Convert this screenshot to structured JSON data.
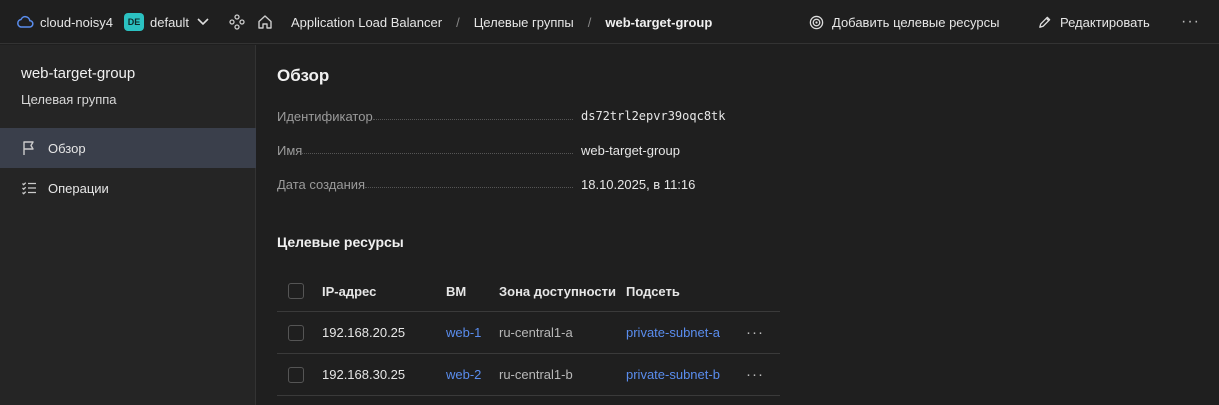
{
  "topbar": {
    "cloud_name": "cloud-noisy4",
    "folder_badge": "DE",
    "folder_name": "default",
    "breadcrumbs": [
      "Application Load Balancer",
      "Целевые группы",
      "web-target-group"
    ],
    "breadcrumb_sep": "/",
    "add_resources_label": "Добавить целевые ресурсы",
    "edit_label": "Редактировать",
    "more_label": "···"
  },
  "sidebar": {
    "title": "web-target-group",
    "subtitle": "Целевая группа",
    "items": [
      {
        "label": "Обзор",
        "icon": "flag-icon",
        "active": true
      },
      {
        "label": "Операции",
        "icon": "list-check-icon",
        "active": false
      }
    ]
  },
  "overview": {
    "heading": "Обзор",
    "properties": [
      {
        "key": "Идентификатор",
        "value": "ds72trl2epvr39oqc8tk"
      },
      {
        "key": "Имя",
        "value": "web-target-group"
      },
      {
        "key": "Дата создания",
        "value": "18.10.2025, в 11:16"
      }
    ]
  },
  "targets": {
    "heading": "Целевые ресурсы",
    "columns": [
      "IP-адрес",
      "ВМ",
      "Зона доступности",
      "Подсеть"
    ],
    "rows": [
      {
        "ip": "192.168.20.25",
        "vm": "web-1",
        "zone": "ru-central1-a",
        "subnet": "private-subnet-a",
        "more": "···"
      },
      {
        "ip": "192.168.30.25",
        "vm": "web-2",
        "zone": "ru-central1-b",
        "subnet": "private-subnet-b",
        "more": "···"
      }
    ]
  },
  "colors": {
    "background": "#1f1f1f",
    "sidebar": "#252525",
    "active_item": "#3a3f4b",
    "link": "#5a8dee",
    "badge": "#2bc1c1"
  }
}
